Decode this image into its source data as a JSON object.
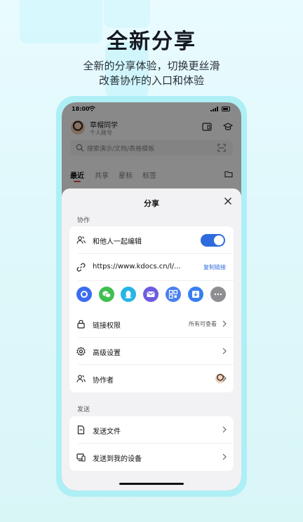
{
  "hero": {
    "title": "全新分享",
    "subtitle_line1": "全新的分享体验，切换更丝滑",
    "subtitle_line2": "改善协作的入口和体验"
  },
  "phone": {
    "status_time": "18:00",
    "user": {
      "name": "草帽同学",
      "subtitle": "个人账号"
    },
    "search_placeholder": "搜索演示/文档/表格模板",
    "tabs": [
      {
        "label": "最近",
        "active": true
      },
      {
        "label": "共享",
        "active": false
      },
      {
        "label": "星标",
        "active": false
      },
      {
        "label": "标签",
        "active": false
      }
    ]
  },
  "share_sheet": {
    "title": "分享",
    "collab_section_label": "协作",
    "edit_together": {
      "label": "和他人一起编辑",
      "enabled": true
    },
    "link": {
      "url": "https://www.kdocs.cn/l/...",
      "copy_label": "复制链接"
    },
    "share_targets": [
      {
        "icon": "kdocs-icon",
        "color": "#3a6cf0"
      },
      {
        "icon": "wechat-icon",
        "color": "#3fbf4f"
      },
      {
        "icon": "qq-icon",
        "color": "#27b5e6"
      },
      {
        "icon": "email-icon",
        "color": "#6b5ce0"
      },
      {
        "icon": "qrcode-icon",
        "color": "#4a7ff0"
      },
      {
        "icon": "save-to-image-icon",
        "color": "#3a7ff0"
      },
      {
        "icon": "more-icon",
        "color": "#8e8e93"
      }
    ],
    "link_permission": {
      "label": "链接权限",
      "value": "所有可查看"
    },
    "advanced_settings": {
      "label": "高级设置"
    },
    "collaborators": {
      "label": "协作者"
    },
    "send_section_label": "发送",
    "send_file": {
      "label": "发送文件"
    },
    "send_to_device": {
      "label": "发送到我的设备"
    }
  },
  "colors": {
    "accent": "#2f6bde",
    "tab_indicator": "#e0474c",
    "phone_frame": "#aeeff6"
  }
}
